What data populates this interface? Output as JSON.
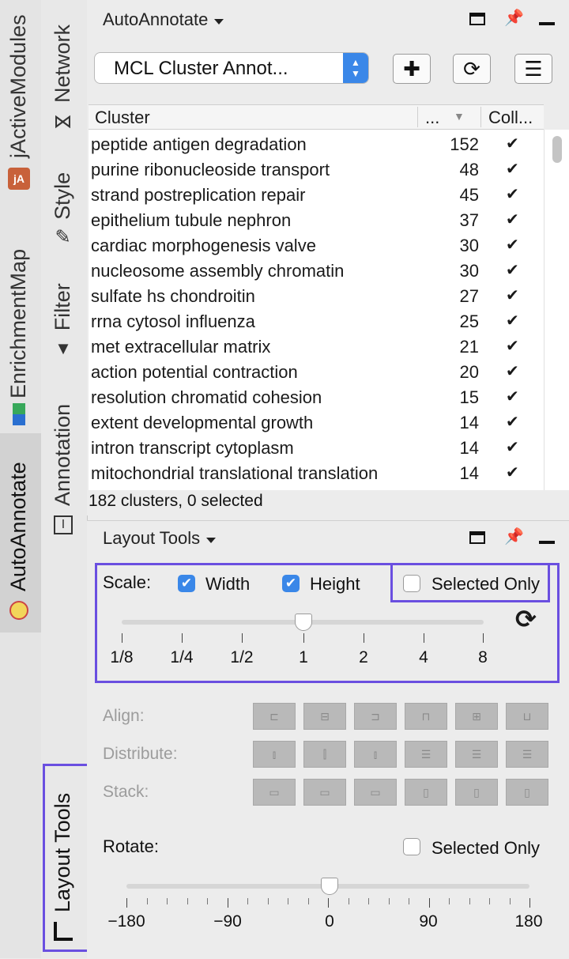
{
  "sidebar_outer": {
    "tabs": [
      {
        "label": "jActiveModules",
        "icon": "jactivemodules-icon"
      },
      {
        "label": "EnrichmentMap",
        "icon": "enrichmentmap-icon"
      },
      {
        "label": "AutoAnnotate",
        "icon": "autoannotate-icon",
        "selected": true
      }
    ]
  },
  "sidebar_inner": {
    "tabs": [
      {
        "label": "Network",
        "icon": "network-icon"
      },
      {
        "label": "Style",
        "icon": "brush-icon"
      },
      {
        "label": "Filter",
        "icon": "filter-icon"
      },
      {
        "label": "Annotation",
        "icon": "annotation-icon"
      },
      {
        "label": "Layout Tools",
        "icon": "ruler-icon",
        "highlighted": true
      }
    ]
  },
  "top_panel": {
    "title": "AutoAnnotate",
    "annotation_set": "MCL Cluster Annot...",
    "table": {
      "headers": [
        "Cluster",
        "...",
        "Coll..."
      ],
      "rows": [
        {
          "cluster": "peptide antigen degradation",
          "count": "152",
          "collapsed": "✔"
        },
        {
          "cluster": "purine ribonucleoside transport",
          "count": "48",
          "collapsed": "✔"
        },
        {
          "cluster": "strand postreplication repair",
          "count": "45",
          "collapsed": "✔"
        },
        {
          "cluster": "epithelium tubule nephron",
          "count": "37",
          "collapsed": "✔"
        },
        {
          "cluster": "cardiac morphogenesis valve",
          "count": "30",
          "collapsed": "✔"
        },
        {
          "cluster": "nucleosome assembly chromatin",
          "count": "30",
          "collapsed": "✔"
        },
        {
          "cluster": "sulfate hs chondroitin",
          "count": "27",
          "collapsed": "✔"
        },
        {
          "cluster": "rrna cytosol influenza",
          "count": "25",
          "collapsed": "✔"
        },
        {
          "cluster": "met extracellular matrix",
          "count": "21",
          "collapsed": "✔"
        },
        {
          "cluster": "action potential contraction",
          "count": "20",
          "collapsed": "✔"
        },
        {
          "cluster": "resolution chromatid cohesion",
          "count": "15",
          "collapsed": "✔"
        },
        {
          "cluster": "extent developmental growth",
          "count": "14",
          "collapsed": "✔"
        },
        {
          "cluster": "intron transcript cytoplasm",
          "count": "14",
          "collapsed": "✔"
        },
        {
          "cluster": "mitochondrial translational translation",
          "count": "14",
          "collapsed": "✔"
        }
      ]
    },
    "status": "182 clusters, 0 selected"
  },
  "layout_tools": {
    "title": "Layout Tools",
    "scale": {
      "label": "Scale:",
      "width_label": "Width",
      "width_checked": true,
      "height_label": "Height",
      "height_checked": true,
      "selected_only_label": "Selected Only",
      "selected_only_checked": false,
      "ticks": [
        "1/8",
        "1/4",
        "1/2",
        "1",
        "2",
        "4",
        "8"
      ],
      "value": "1"
    },
    "align_label": "Align:",
    "distribute_label": "Distribute:",
    "stack_label": "Stack:",
    "rotate": {
      "label": "Rotate:",
      "selected_only_label": "Selected Only",
      "selected_only_checked": false,
      "ticks": [
        "−180",
        "−90",
        "0",
        "90",
        "180"
      ],
      "value": 0
    }
  },
  "colors": {
    "accent": "#3a87e8",
    "highlight": "#6a4fe0"
  }
}
